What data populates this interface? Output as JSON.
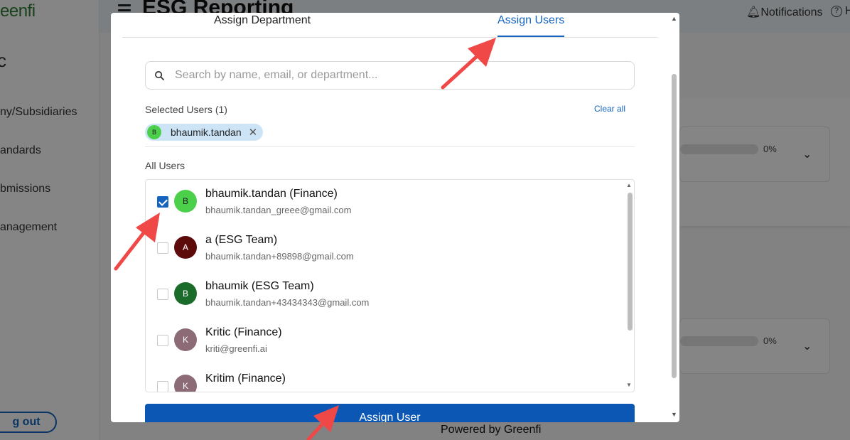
{
  "app": {
    "logo": "eenfi",
    "company_initial": "c",
    "page_title": "ESG Reporting",
    "notifications": "Notifications",
    "help_icon": "question-circle-icon",
    "help_tail": "H",
    "sidebar": [
      "ny/Subsidiaries",
      "andards",
      "bmissions",
      "anagement"
    ],
    "logout": "g out",
    "cards": [
      {
        "percent": "0%"
      },
      {
        "percent": "0%"
      }
    ],
    "footer": "Powered by Greenfi"
  },
  "modal": {
    "tabs": [
      {
        "label": "Assign Department",
        "active": false
      },
      {
        "label": "Assign Users",
        "active": true
      }
    ],
    "search": {
      "placeholder": "Search by name, email, or department...",
      "value": ""
    },
    "selected_label": "Selected Users (1)",
    "clear_all": "Clear all",
    "selected_chips": [
      {
        "initial": "B",
        "name": "bhaumik.tandan"
      }
    ],
    "all_users_label": "All Users",
    "users": [
      {
        "initial": "B",
        "name": "bhaumik.tandan (Finance)",
        "email": "bhaumik.tandan_greee@gmail.com",
        "checked": true,
        "color": "#4cd04c"
      },
      {
        "initial": "A",
        "name": "a (ESG Team)",
        "email": "bhaumik.tandan+89898@gmail.com",
        "checked": false,
        "color": "#5c0a0a"
      },
      {
        "initial": "B",
        "name": "bhaumik (ESG Team)",
        "email": "bhaumik.tandan+43434343@gmail.com",
        "checked": false,
        "color": "#1b6b2a"
      },
      {
        "initial": "K",
        "name": "Kritic (Finance)",
        "email": "kriti@greenfi.ai",
        "checked": false,
        "color": "#8c6b76"
      },
      {
        "initial": "K",
        "name": "Kritim (Finance)",
        "email": "",
        "checked": false,
        "color": "#8c6b76"
      }
    ],
    "assign_button": "Assign User"
  },
  "colors": {
    "accent": "#1565c0",
    "primary_button": "#0b57b3",
    "annotation_arrow": "#f04747"
  }
}
